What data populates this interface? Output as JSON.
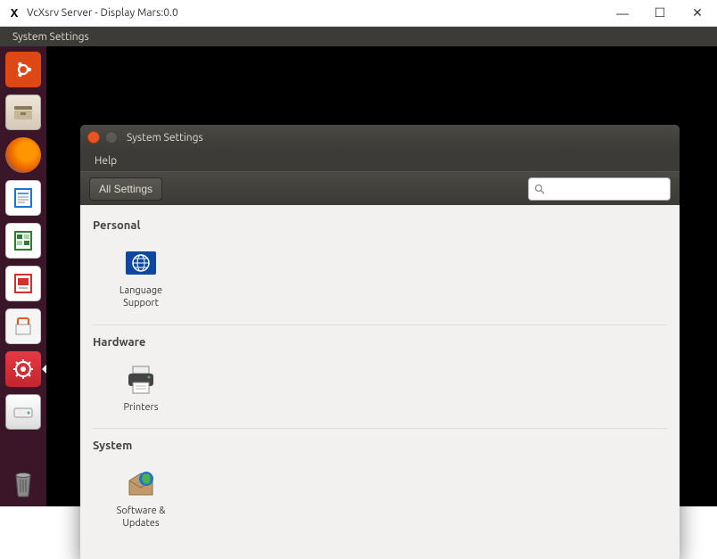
{
  "win": {
    "title": "VcXsrv Server - Display Mars:0.0",
    "min": "—",
    "max": "☐",
    "close": "✕"
  },
  "menubar": {
    "item1": "System Settings"
  },
  "launcher": {
    "ubuntu": "ubuntu-logo",
    "files": "files",
    "firefox": "firefox",
    "writer": "writer",
    "calc": "calc",
    "impress": "impress",
    "software": "software-center",
    "settings": "settings",
    "drive": "drive",
    "trash": "trash"
  },
  "settings": {
    "title": "System Settings",
    "menu": {
      "help": "Help"
    },
    "toolbar": {
      "all": "All Settings",
      "search_placeholder": ""
    },
    "sections": {
      "personal": {
        "title": "Personal",
        "items": [
          {
            "label": "Language Support"
          }
        ]
      },
      "hardware": {
        "title": "Hardware",
        "items": [
          {
            "label": "Printers"
          }
        ]
      },
      "system": {
        "title": "System",
        "items": [
          {
            "label": "Software & Updates"
          }
        ]
      }
    }
  }
}
